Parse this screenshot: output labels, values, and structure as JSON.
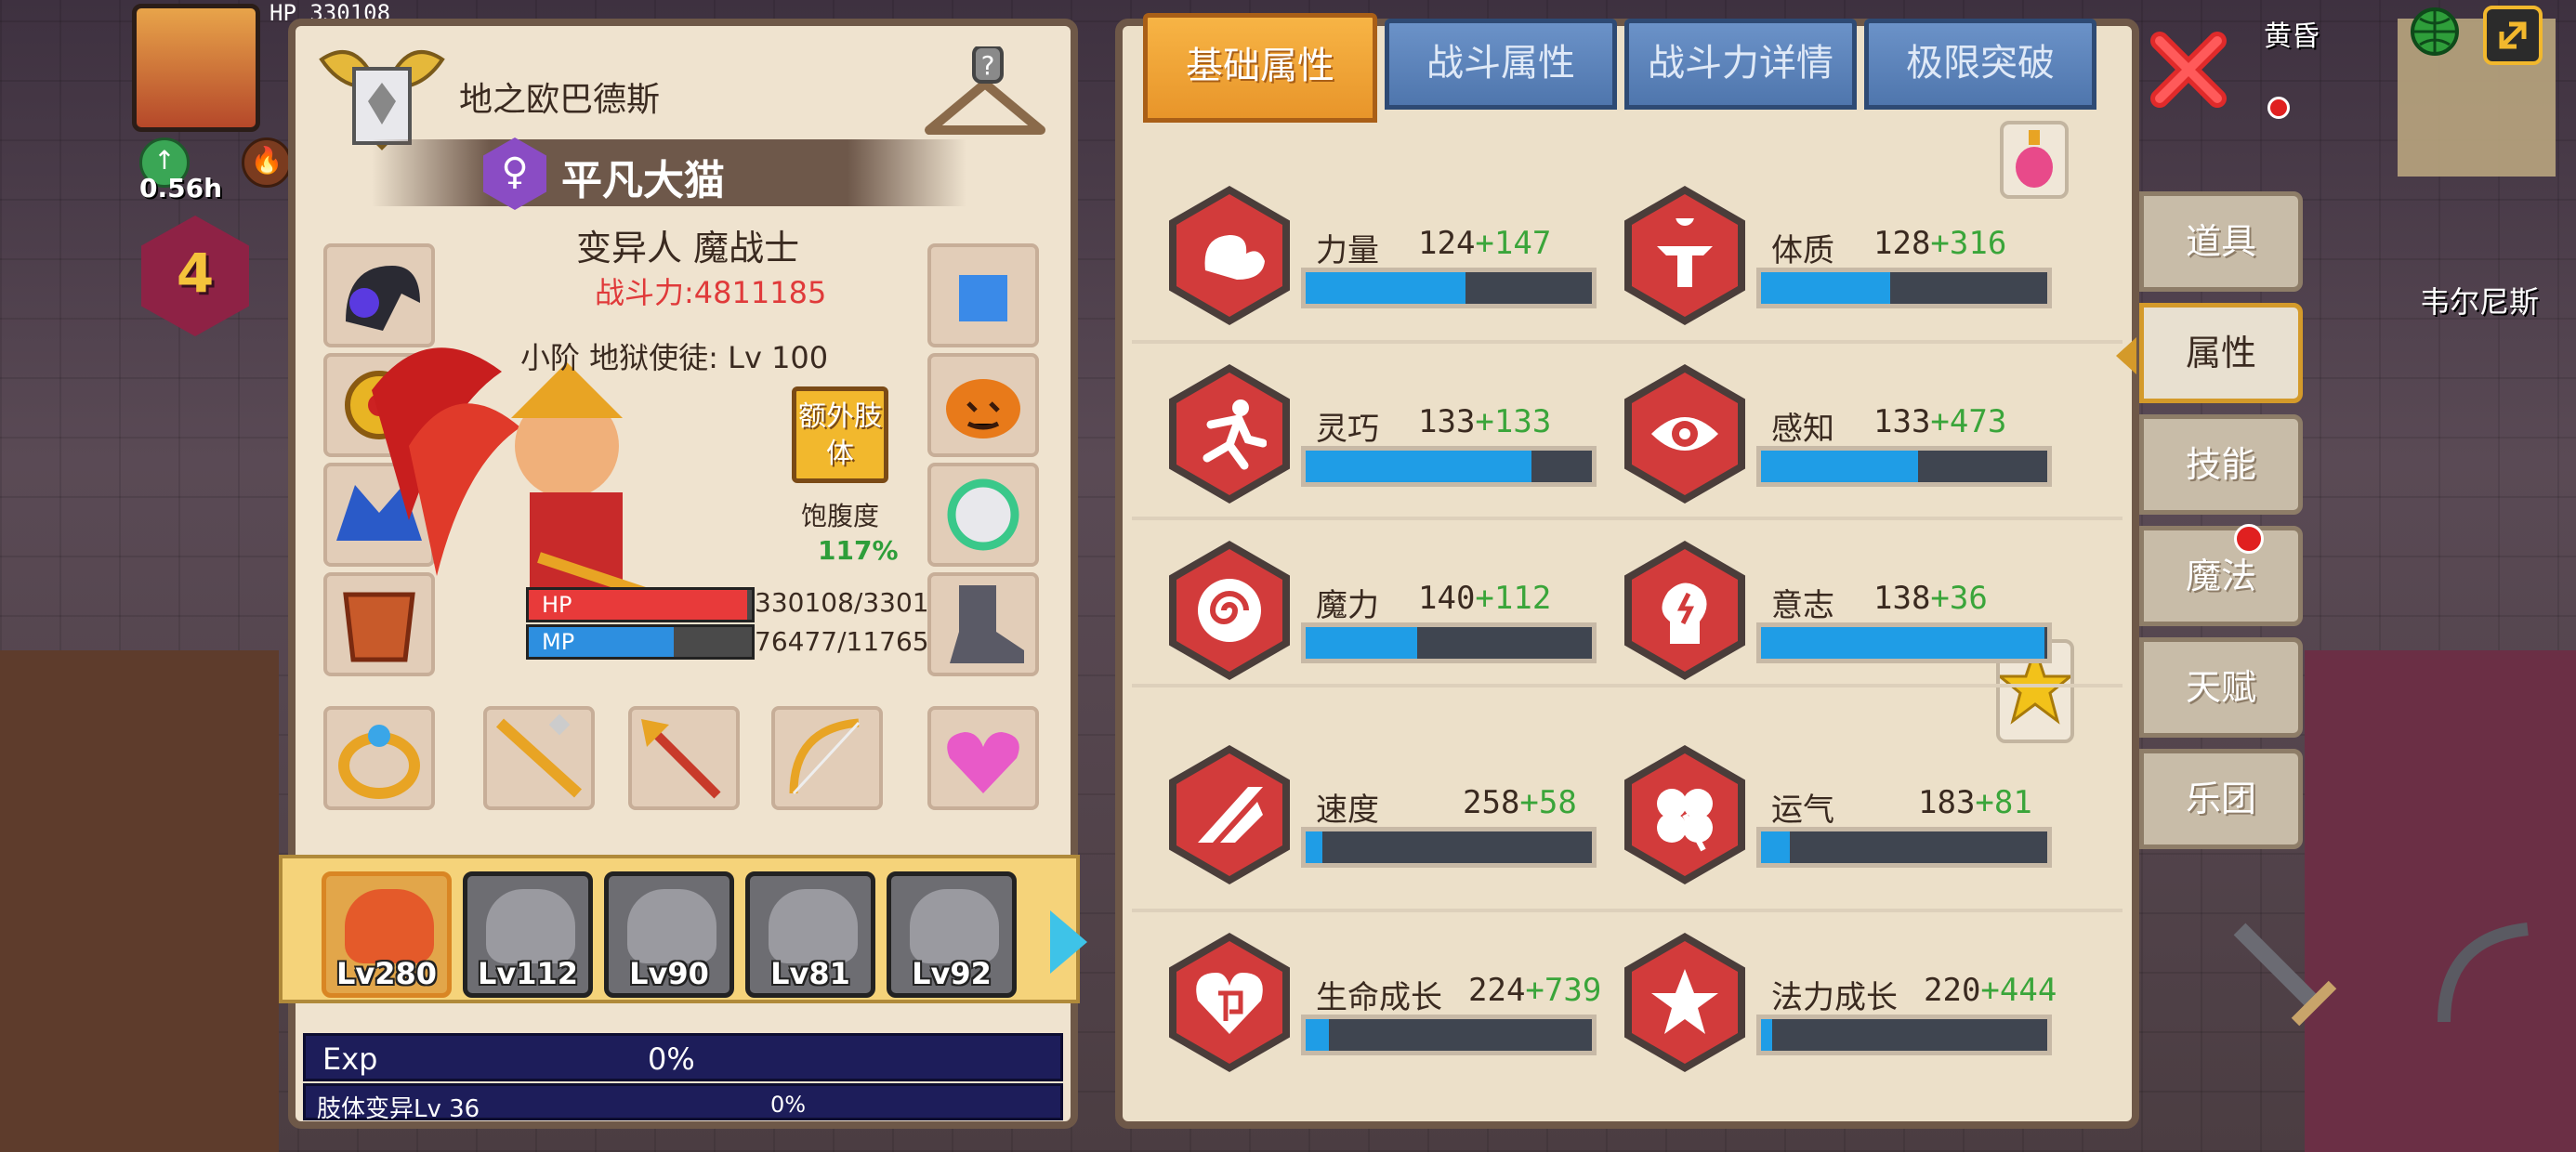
{
  "hud": {
    "hp_label": "HP",
    "hp_value": "330108",
    "time": "0.56h",
    "level": "4",
    "town_name": "韦尔尼斯",
    "top_right_text": "黄昏"
  },
  "character": {
    "guild": "地之欧巴德斯",
    "gender_symbol": "♀",
    "name": "平凡大猫",
    "class": "变异人 魔战士",
    "power": "战斗力:4811185",
    "rank": "小阶 地狱使徒: Lv 100",
    "extra_limb": "额外肢体",
    "satiety_label": "饱腹度",
    "satiety_value": "117%",
    "hp_label": "HP",
    "hp_value": "330108/3301",
    "hp_fraction": 0.98,
    "mp_label": "MP",
    "mp_value": "76477/11765",
    "mp_fraction": 0.65
  },
  "party": [
    {
      "level": "Lv280",
      "active": true
    },
    {
      "level": "Lv112",
      "active": false
    },
    {
      "level": "Lv90",
      "active": false
    },
    {
      "level": "Lv81",
      "active": false
    },
    {
      "level": "Lv92",
      "active": false
    }
  ],
  "exp": {
    "label": "Exp",
    "value": "0%",
    "limb_label": "肢体变异Lv 36",
    "limb_value": "0%"
  },
  "tabs": [
    "基础属性",
    "战斗属性",
    "战斗力详情",
    "极限突破"
  ],
  "active_tab": 0,
  "stats": [
    {
      "name": "力量",
      "base": "124",
      "bonus": "+147",
      "fill": 0.56,
      "icon": "muscle-icon"
    },
    {
      "name": "体质",
      "base": "128",
      "bonus": "+316",
      "fill": 0.45,
      "icon": "bodybuilder-icon"
    },
    {
      "name": "灵巧",
      "base": "133",
      "bonus": "+133",
      "fill": 0.79,
      "icon": "runner-icon"
    },
    {
      "name": "感知",
      "base": "133",
      "bonus": "+473",
      "fill": 0.55,
      "icon": "eye-icon"
    },
    {
      "name": "魔力",
      "base": "140",
      "bonus": "+112",
      "fill": 0.39,
      "icon": "spiral-icon"
    },
    {
      "name": "意志",
      "base": "138",
      "bonus": "+36",
      "fill": 0.99,
      "icon": "head-icon"
    },
    {
      "name": "速度",
      "base": "258",
      "bonus": "+58",
      "fill": 0.06,
      "icon": "wind-icon"
    },
    {
      "name": "运气",
      "base": "183",
      "bonus": "+81",
      "fill": 0.1,
      "icon": "clover-icon"
    },
    {
      "name": "生命成长",
      "base": "224",
      "bonus": "+739",
      "fill": 0.08,
      "icon": "heart-icon"
    },
    {
      "name": "法力成长",
      "base": "220",
      "bonus": "+444",
      "fill": 0.04,
      "icon": "star-icon"
    }
  ],
  "side_menu": [
    "道具",
    "属性",
    "技能",
    "魔法",
    "天赋",
    "乐团"
  ],
  "active_side": 1,
  "colors": {
    "stat_icon": "#d23b3b",
    "stat_bar_fill": "#1f9de6",
    "bonus_green": "#3aa53a",
    "tab_active": "#f7b445",
    "tab_inactive": "#5b82bb"
  }
}
